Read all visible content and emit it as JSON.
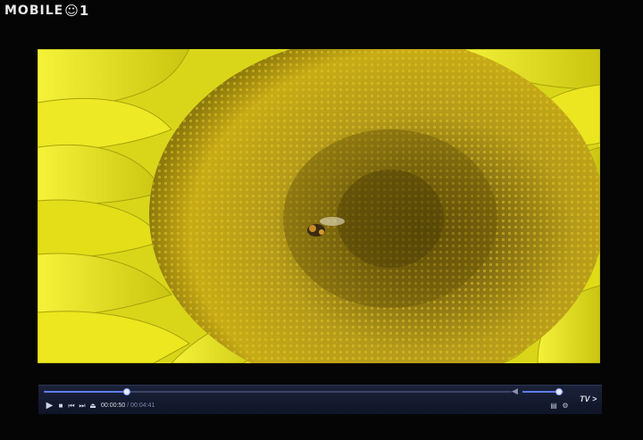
{
  "watermark": {
    "text": "MOBILE",
    "icon": "smiley-logo"
  },
  "player": {
    "current_time": "00:00:50",
    "time_separator": "/",
    "total_time": "00:04:41",
    "progress_fraction": 0.1777,
    "volume_fraction": 0.9,
    "tv_label": "TV",
    "tv_chevron": ">",
    "controls": {
      "play": "▶",
      "stop": "■",
      "prev": "⏮",
      "next": "⏭",
      "eject": "⏏"
    },
    "right_icons": {
      "playlist": "▤",
      "settings": "⚙"
    },
    "volume_icon": "◀"
  },
  "video": {
    "subject": "sunflower-closeup-with-bee"
  },
  "colors": {
    "accent": "#5d7be8",
    "bar_bg": "#141a2e",
    "petal": "#e9e41a",
    "disk": "#b89a12"
  }
}
